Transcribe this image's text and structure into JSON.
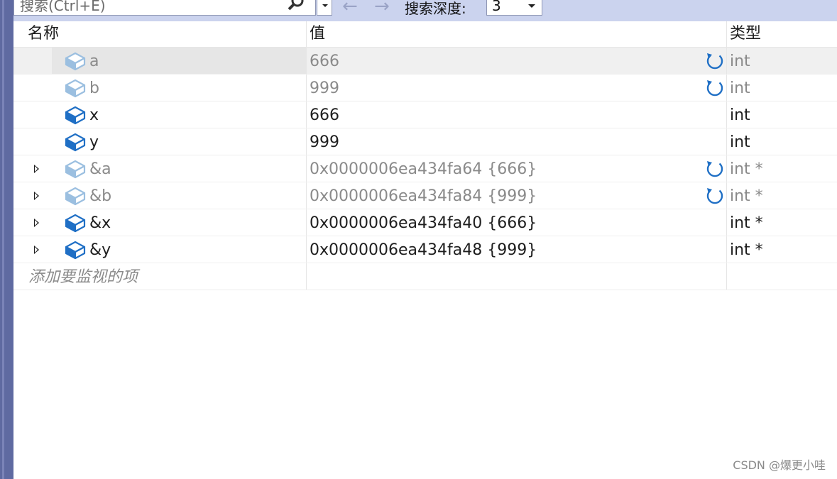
{
  "toolbar": {
    "search_placeholder": "搜索(Ctrl+E)",
    "search_depth_label": "搜索深度:",
    "search_depth_value": "3",
    "back_arrow": "←",
    "forward_arrow": "→"
  },
  "columns": {
    "name": "名称",
    "value": "值",
    "type": "类型"
  },
  "rows": [
    {
      "name": "a",
      "value": "666",
      "type": "int",
      "stale": true,
      "refresh": true,
      "expandable": false,
      "selected": true
    },
    {
      "name": "b",
      "value": "999",
      "type": "int",
      "stale": true,
      "refresh": true,
      "expandable": false,
      "selected": false
    },
    {
      "name": "x",
      "value": "666",
      "type": "int",
      "stale": false,
      "refresh": false,
      "expandable": false,
      "selected": false
    },
    {
      "name": "y",
      "value": "999",
      "type": "int",
      "stale": false,
      "refresh": false,
      "expandable": false,
      "selected": false
    },
    {
      "name": "&a",
      "value": "0x0000006ea434fa64 {666}",
      "type": "int *",
      "stale": true,
      "refresh": true,
      "expandable": true,
      "selected": false
    },
    {
      "name": "&b",
      "value": "0x0000006ea434fa84 {999}",
      "type": "int *",
      "stale": true,
      "refresh": true,
      "expandable": true,
      "selected": false
    },
    {
      "name": "&x",
      "value": "0x0000006ea434fa40 {666}",
      "type": "int *",
      "stale": false,
      "refresh": false,
      "expandable": true,
      "selected": false
    },
    {
      "name": "&y",
      "value": "0x0000006ea434fa48 {999}",
      "type": "int *",
      "stale": false,
      "refresh": false,
      "expandable": true,
      "selected": false
    }
  ],
  "add_watch_placeholder": "添加要监视的项",
  "watermark": "CSDN @爆更小哇",
  "colors": {
    "icon_active": "#1f6fc5",
    "icon_stale": "#9bbfe0",
    "refresh": "#1f6fc5",
    "toolbar_bg": "#cbd3ee"
  }
}
